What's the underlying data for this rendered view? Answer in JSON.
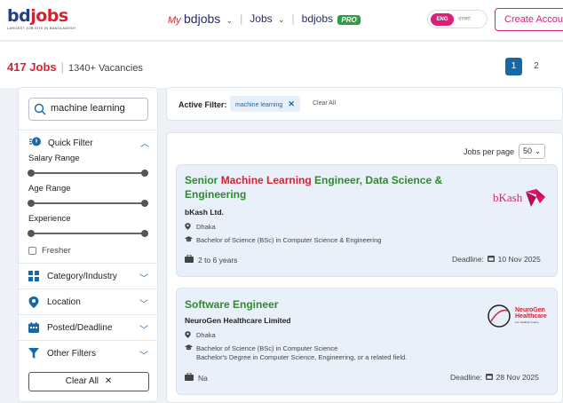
{
  "header": {
    "logo_bd": "bd",
    "logo_jobs": "jobs",
    "logo_tagline": "LARGEST JOB SITE IN BANGLADESH",
    "nav": {
      "my_prefix": "My",
      "my_label": "bdjobs",
      "jobs_label": "Jobs",
      "pro_label": "bdjobs",
      "pro_badge": "PRO"
    },
    "lang_active": "ENG",
    "lang_other": "বাংলা",
    "create_account": "Create Account"
  },
  "summary": {
    "jobs_count": "417 Jobs",
    "vacancies": "1340+ Vacancies"
  },
  "pagination": [
    "1",
    "2"
  ],
  "sidebar": {
    "search_value": "machine learning",
    "quick_filter": "Quick Filter",
    "salary_range": "Salary Range",
    "age_range": "Age Range",
    "experience": "Experience",
    "fresher": "Fresher",
    "filters": [
      {
        "label": "Category/Industry",
        "icon": "grid-icon"
      },
      {
        "label": "Location",
        "icon": "location-pin-icon"
      },
      {
        "label": "Posted/Deadline",
        "icon": "calendar-icon"
      },
      {
        "label": "Other Filters",
        "icon": "funnel-icon"
      }
    ],
    "clear_all": "Clear All",
    "clear_all_icon": "✕"
  },
  "active_filter": {
    "label": "Active Filter:",
    "chip": "machine learning",
    "chip_close": "✕",
    "clear": "Clear All"
  },
  "list": {
    "per_page_label": "Jobs per page",
    "per_page_value": "50"
  },
  "jobs": [
    {
      "title_pre": "Senior ",
      "title_highlight": "Machine Learning",
      "title_post": " Engineer, Data Science &",
      "title_line2": "Engineering",
      "company": "bKash Ltd.",
      "location": "Dhaka",
      "education": "Bachelor of Science (BSc) in Computer Science & Engineering",
      "experience": "2 to 6 years",
      "deadline_label": "Deadline:",
      "deadline": "10 Nov 2025",
      "logo_text": "bKash"
    },
    {
      "title": "Software Engineer",
      "company": "NeuroGen Healthcare Limited",
      "location": "Dhaka",
      "education": "Bachelor of Science (BSc) in Computer Science",
      "education_line2": "Bachelor's Degree in Computer Science, Engineering, or a related field.",
      "experience": "Na",
      "deadline_label": "Deadline:",
      "deadline": "28 Nov 2025",
      "logo_line1": "NeuroGen",
      "logo_line2": "Healthcare",
      "logo_line3": "For Healthier Future"
    }
  ],
  "colors": {
    "brand_red": "#d9202e",
    "brand_blue": "#1668a8",
    "title_green": "#2e8b2e",
    "pink": "#d9217a"
  }
}
